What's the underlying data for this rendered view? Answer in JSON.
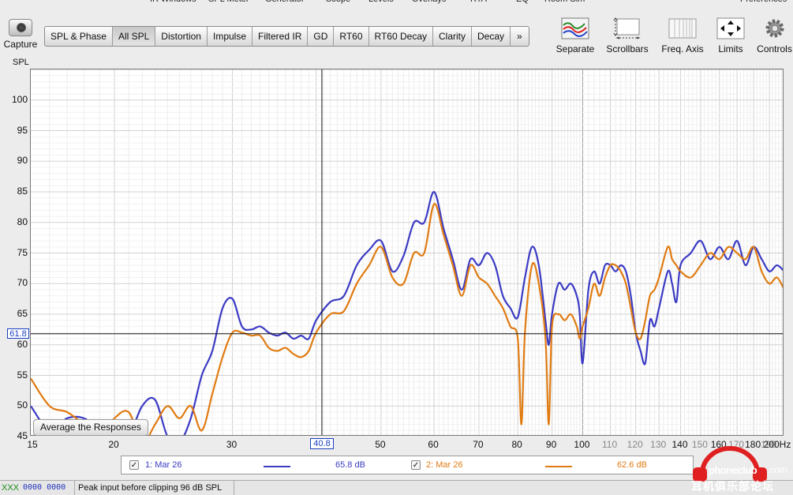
{
  "top_menu": [
    "IR Windows",
    "SPL Meter",
    "Generator",
    "Scope",
    "Levels",
    "Overlays",
    "RTA",
    "EQ",
    "Room Sim",
    "Preferences"
  ],
  "capture_label": "Capture",
  "tabs": [
    "SPL & Phase",
    "All SPL",
    "Distortion",
    "Impulse",
    "Filtered IR",
    "GD",
    "RT60",
    "RT60 Decay",
    "Clarity",
    "Decay",
    "»"
  ],
  "active_tab": "All SPL",
  "tools": {
    "separate": "Separate",
    "scrollbars": "Scrollbars",
    "freq_axis": "Freq. Axis",
    "limits": "Limits",
    "controls": "Controls"
  },
  "y_axis_label": "SPL",
  "y_ticks": [
    "100",
    "95",
    "90",
    "85",
    "80",
    "75",
    "70",
    "65",
    "60",
    "55",
    "50",
    "45"
  ],
  "x_ticks": [
    "15",
    "20",
    "30",
    "40",
    "50",
    "60",
    "70",
    "80",
    "90",
    "100",
    "110",
    "120",
    "130",
    "140",
    "150",
    "160",
    "170",
    "180",
    "190",
    "200Hz"
  ],
  "cursor_y_label": "61.8",
  "cursor_x_label": "40.8",
  "average_button_label": "Average the Responses",
  "legend": [
    {
      "index": "1: Mar 26",
      "value": "65.8 dB",
      "color": "#3b3bc4",
      "checked": "✓"
    },
    {
      "index": "2: Mar 26",
      "value": "62.6 dB",
      "color": "#e07b12",
      "checked": "✓"
    }
  ],
  "status": {
    "xxx": "XXX",
    "level": "0000 0000",
    "message": "Peak input before clipping 96 dB SPL"
  },
  "watermark": {
    "brand": "phoneclub",
    "suffix": ".com",
    "cn": "耳机俱乐部论坛"
  },
  "chart_data": {
    "type": "line",
    "xscale": "log",
    "xlim": [
      15,
      200
    ],
    "ylim": [
      45,
      105
    ],
    "ylabel": "SPL",
    "xunit": "Hz",
    "cursor": {
      "x": 40.8,
      "y": 61.8
    },
    "grid": true,
    "series": [
      {
        "name": "1: Mar 26",
        "color": "#3b3bc4",
        "points": [
          [
            15,
            50
          ],
          [
            16,
            46
          ],
          [
            17,
            48
          ],
          [
            18,
            48
          ],
          [
            19,
            46
          ],
          [
            20,
            44
          ],
          [
            21,
            45
          ],
          [
            22,
            50
          ],
          [
            23,
            51
          ],
          [
            24,
            45
          ],
          [
            25,
            44
          ],
          [
            26,
            48
          ],
          [
            27,
            55
          ],
          [
            28,
            59
          ],
          [
            29,
            66
          ],
          [
            30,
            67.5
          ],
          [
            31,
            63
          ],
          [
            32,
            62.5
          ],
          [
            33,
            63
          ],
          [
            34,
            62
          ],
          [
            35,
            61.5
          ],
          [
            36,
            62
          ],
          [
            37,
            61
          ],
          [
            38,
            61.5
          ],
          [
            39,
            61
          ],
          [
            40,
            64
          ],
          [
            42,
            67
          ],
          [
            44,
            68
          ],
          [
            46,
            73
          ],
          [
            48,
            75.5
          ],
          [
            50,
            77
          ],
          [
            52,
            72
          ],
          [
            54,
            74.5
          ],
          [
            56,
            80
          ],
          [
            58,
            80
          ],
          [
            60,
            85
          ],
          [
            62,
            79
          ],
          [
            64,
            74
          ],
          [
            66,
            69
          ],
          [
            68,
            74
          ],
          [
            70,
            73
          ],
          [
            72,
            75
          ],
          [
            74,
            73
          ],
          [
            76,
            68
          ],
          [
            78,
            66
          ],
          [
            80,
            64.5
          ],
          [
            82,
            71
          ],
          [
            84,
            76
          ],
          [
            86,
            73
          ],
          [
            88,
            64
          ],
          [
            89,
            60
          ],
          [
            90,
            65
          ],
          [
            92,
            70
          ],
          [
            94,
            69
          ],
          [
            96,
            70
          ],
          [
            98,
            68
          ],
          [
            99,
            65
          ],
          [
            100,
            57
          ],
          [
            102,
            69
          ],
          [
            104,
            72
          ],
          [
            106,
            70
          ],
          [
            108,
            73
          ],
          [
            110,
            73
          ],
          [
            112,
            72
          ],
          [
            114,
            73
          ],
          [
            116,
            72
          ],
          [
            118,
            68
          ],
          [
            120,
            62
          ],
          [
            122,
            59
          ],
          [
            124,
            57
          ],
          [
            126,
            64
          ],
          [
            128,
            63
          ],
          [
            130,
            66
          ],
          [
            134,
            72
          ],
          [
            136,
            70
          ],
          [
            138,
            67
          ],
          [
            140,
            73
          ],
          [
            145,
            75
          ],
          [
            150,
            77
          ],
          [
            155,
            74
          ],
          [
            160,
            76
          ],
          [
            165,
            74
          ],
          [
            170,
            77
          ],
          [
            175,
            73
          ],
          [
            180,
            76
          ],
          [
            185,
            74
          ],
          [
            190,
            72
          ],
          [
            195,
            73
          ],
          [
            200,
            72
          ]
        ]
      },
      {
        "name": "2: Mar 26",
        "color": "#e07b12",
        "points": [
          [
            15,
            54.5
          ],
          [
            16,
            50
          ],
          [
            17,
            49
          ],
          [
            18,
            47
          ],
          [
            19,
            45
          ],
          [
            20,
            48
          ],
          [
            21,
            49
          ],
          [
            22,
            44
          ],
          [
            23,
            47
          ],
          [
            24,
            50
          ],
          [
            25,
            48
          ],
          [
            26,
            50
          ],
          [
            27,
            46
          ],
          [
            28,
            52
          ],
          [
            29,
            58
          ],
          [
            30,
            62
          ],
          [
            31,
            62
          ],
          [
            32,
            61.5
          ],
          [
            33,
            61.5
          ],
          [
            34,
            59.5
          ],
          [
            35,
            59
          ],
          [
            36,
            59.5
          ],
          [
            37,
            58.5
          ],
          [
            38,
            58
          ],
          [
            39,
            59
          ],
          [
            40,
            62
          ],
          [
            42,
            65
          ],
          [
            44,
            65.5
          ],
          [
            46,
            70
          ],
          [
            48,
            73
          ],
          [
            50,
            76
          ],
          [
            52,
            71
          ],
          [
            54,
            70
          ],
          [
            56,
            75
          ],
          [
            58,
            75
          ],
          [
            60,
            83
          ],
          [
            62,
            78
          ],
          [
            64,
            73
          ],
          [
            66,
            68
          ],
          [
            68,
            73
          ],
          [
            70,
            71
          ],
          [
            72,
            70
          ],
          [
            74,
            68
          ],
          [
            76,
            66
          ],
          [
            78,
            63
          ],
          [
            80,
            61
          ],
          [
            81,
            47
          ],
          [
            82,
            62
          ],
          [
            84,
            73
          ],
          [
            86,
            70
          ],
          [
            88,
            61
          ],
          [
            89,
            47
          ],
          [
            90,
            63
          ],
          [
            92,
            65
          ],
          [
            94,
            64
          ],
          [
            96,
            65
          ],
          [
            98,
            63
          ],
          [
            99,
            61
          ],
          [
            100,
            63
          ],
          [
            102,
            66
          ],
          [
            104,
            70
          ],
          [
            106,
            68
          ],
          [
            108,
            71
          ],
          [
            110,
            73
          ],
          [
            112,
            73
          ],
          [
            114,
            72
          ],
          [
            116,
            70
          ],
          [
            118,
            66
          ],
          [
            120,
            62
          ],
          [
            122,
            61
          ],
          [
            124,
            64
          ],
          [
            126,
            68
          ],
          [
            128,
            69
          ],
          [
            130,
            71
          ],
          [
            134,
            76
          ],
          [
            136,
            74
          ],
          [
            138,
            73
          ],
          [
            140,
            72
          ],
          [
            145,
            71
          ],
          [
            150,
            73
          ],
          [
            155,
            75
          ],
          [
            160,
            74
          ],
          [
            165,
            76
          ],
          [
            170,
            75
          ],
          [
            175,
            74
          ],
          [
            180,
            76
          ],
          [
            185,
            72
          ],
          [
            190,
            70
          ],
          [
            195,
            71
          ],
          [
            200,
            69
          ]
        ]
      }
    ]
  }
}
